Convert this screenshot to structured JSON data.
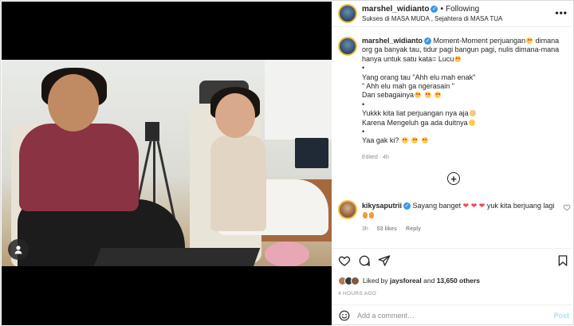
{
  "header": {
    "username": "marshel_widianto",
    "follow_state": "Following",
    "subtitle": "Sukses di MASA MUDA , Sejahtera di MASA TUA",
    "more_icon": "more-horizontal-icon"
  },
  "caption": {
    "username": "marshel_widianto",
    "line1": "Moment-Moment perjuangan",
    "line1b": " dimana org ga banyak tau, tidur pagi bangun pagi, nulis dimana-mana hanya untuk satu kata= Lucu",
    "bullet": "•",
    "line2": "Yang orang tau \"Ahh elu mah enak\"",
    "line3": "\" Ahh elu mah ga ngerasain \"",
    "line4": "Dan sebagainya",
    "line5": "Yukkk kita liat perjuangan nya aja",
    "line6": "Karena Mengeluh ga ada duitnya",
    "line7": "Yaa gak ki?",
    "meta": "Edited · 4h"
  },
  "comment": {
    "username": "kikysaputrii",
    "text_a": "Sayang banget",
    "text_b": "yuk kita berjuang lagi",
    "time": "3h",
    "likes": "53 likes",
    "reply": "Reply"
  },
  "actions": {
    "liked_prefix": "Liked by",
    "liked_user": "jaysforeal",
    "liked_and": "and",
    "liked_others": "13,650 others",
    "time_ago": "4 HOURS AGO"
  },
  "add_comment": {
    "placeholder": "Add a comment…",
    "post_label": "Post"
  },
  "colors": {
    "verified": "#3897f0",
    "like_red": "#ed4956",
    "post_disabled": "#b2dffc",
    "meta_gray": "#8e8e8e"
  }
}
